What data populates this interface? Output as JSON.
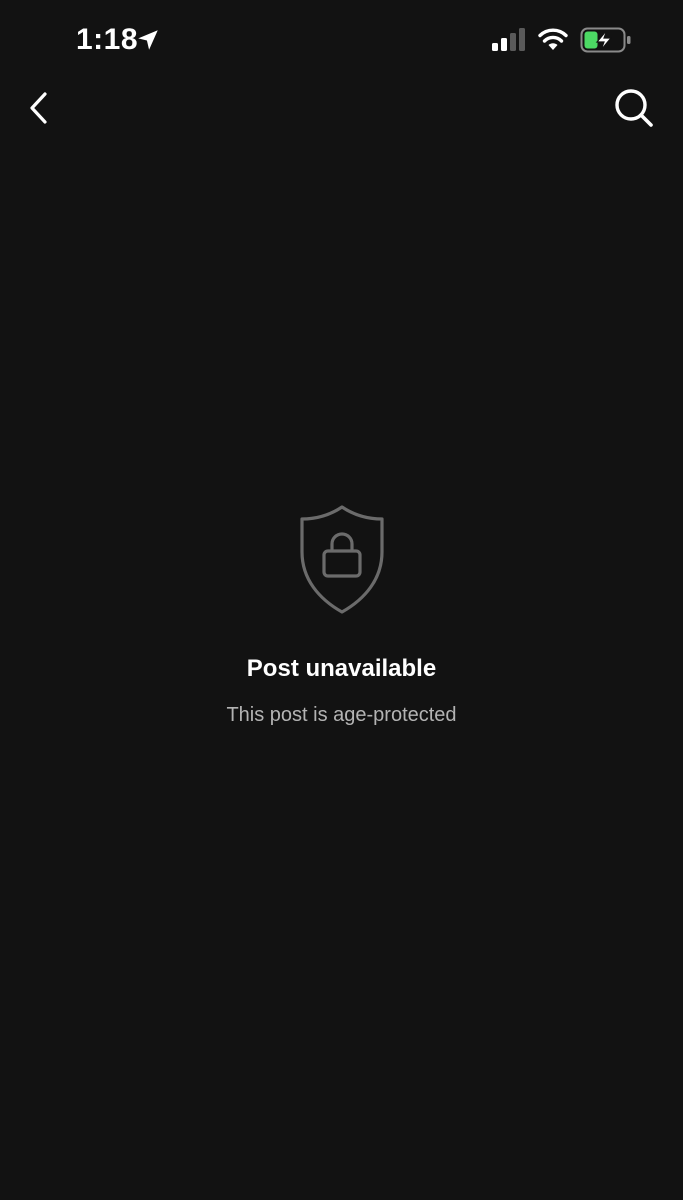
{
  "status_bar": {
    "time": "1:18",
    "icons": [
      "location-arrow-icon",
      "cellular-signal-icon",
      "wifi-icon",
      "battery-charging-icon"
    ],
    "battery_color": "#4cd964"
  },
  "nav": {
    "back_icon": "chevron-left-icon",
    "search_icon": "search-icon"
  },
  "message": {
    "icon": "shield-lock-icon",
    "title": "Post unavailable",
    "subtitle": "This post is age-protected"
  },
  "colors": {
    "background": "#121212",
    "title": "#ffffff",
    "subtitle": "#b3b3b3",
    "icon_muted": "#6b6b6b"
  }
}
